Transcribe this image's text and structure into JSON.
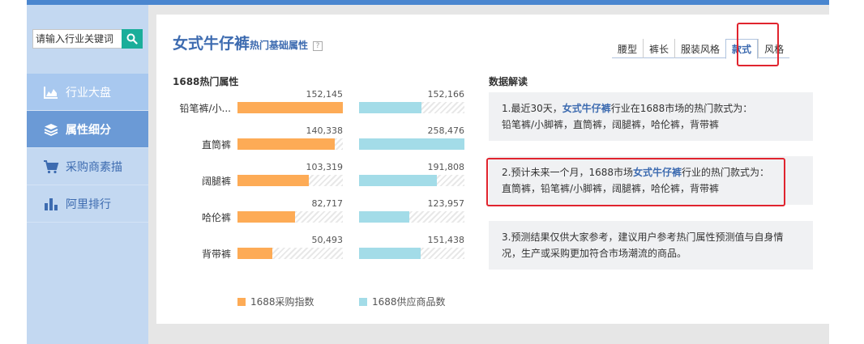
{
  "search": {
    "placeholder": "请输入行业关键词"
  },
  "sidebar": {
    "items": [
      {
        "label": "行业大盘",
        "icon": "area-chart-icon"
      },
      {
        "label": "属性细分",
        "icon": "layers-icon"
      },
      {
        "label": "采购商素描",
        "icon": "cart-icon"
      },
      {
        "label": "阿里排行",
        "icon": "bar-chart-icon"
      }
    ]
  },
  "header": {
    "title": "女式牛仔裤",
    "subtitle": "热门基础属性",
    "help": "?"
  },
  "tabs": [
    "腰型",
    "裤长",
    "服装风格",
    "款式",
    "风格"
  ],
  "active_tab": "款式",
  "chart_section_title": "1688热门属性",
  "chart_data": {
    "type": "bar",
    "categories": [
      "铅笔裤/小...",
      "直筒裤",
      "阔腿裤",
      "哈伦裤",
      "背带裤"
    ],
    "series": [
      {
        "name": "1688采购指数",
        "values": [
          152145,
          140338,
          103319,
          82717,
          50493
        ],
        "labels": [
          "152,145",
          "140,338",
          "103,319",
          "82,717",
          "50,493"
        ],
        "color": "#fdab56"
      },
      {
        "name": "1688供应商品数",
        "values": [
          152166,
          258476,
          191808,
          123957,
          151438
        ],
        "labels": [
          "152,166",
          "258,476",
          "191,808",
          "123,957",
          "151,438"
        ],
        "color": "#a3dce8"
      }
    ]
  },
  "interpretation": {
    "title": "数据解读",
    "item1": {
      "prefix": "1.最近30天，",
      "highlight": "女式牛仔裤",
      "suffix": "行业在1688市场的热门款式为：",
      "line2": "铅笔裤/小脚裤，直筒裤，阔腿裤，哈伦裤，背带裤"
    },
    "item2": {
      "prefix": "2.预计未来一个月，1688市场",
      "highlight": "女式牛仔裤",
      "suffix": "行业的热门款式为：",
      "line2": "直筒裤，铅笔裤/小脚裤，阔腿裤，哈伦裤，背带裤"
    },
    "item3": {
      "line1": "3.预测结果仅供大家参考，建议用户参考热门属性预测值与自身情",
      "line2": "况，生产或采购更加符合市场潮流的商品。"
    }
  }
}
